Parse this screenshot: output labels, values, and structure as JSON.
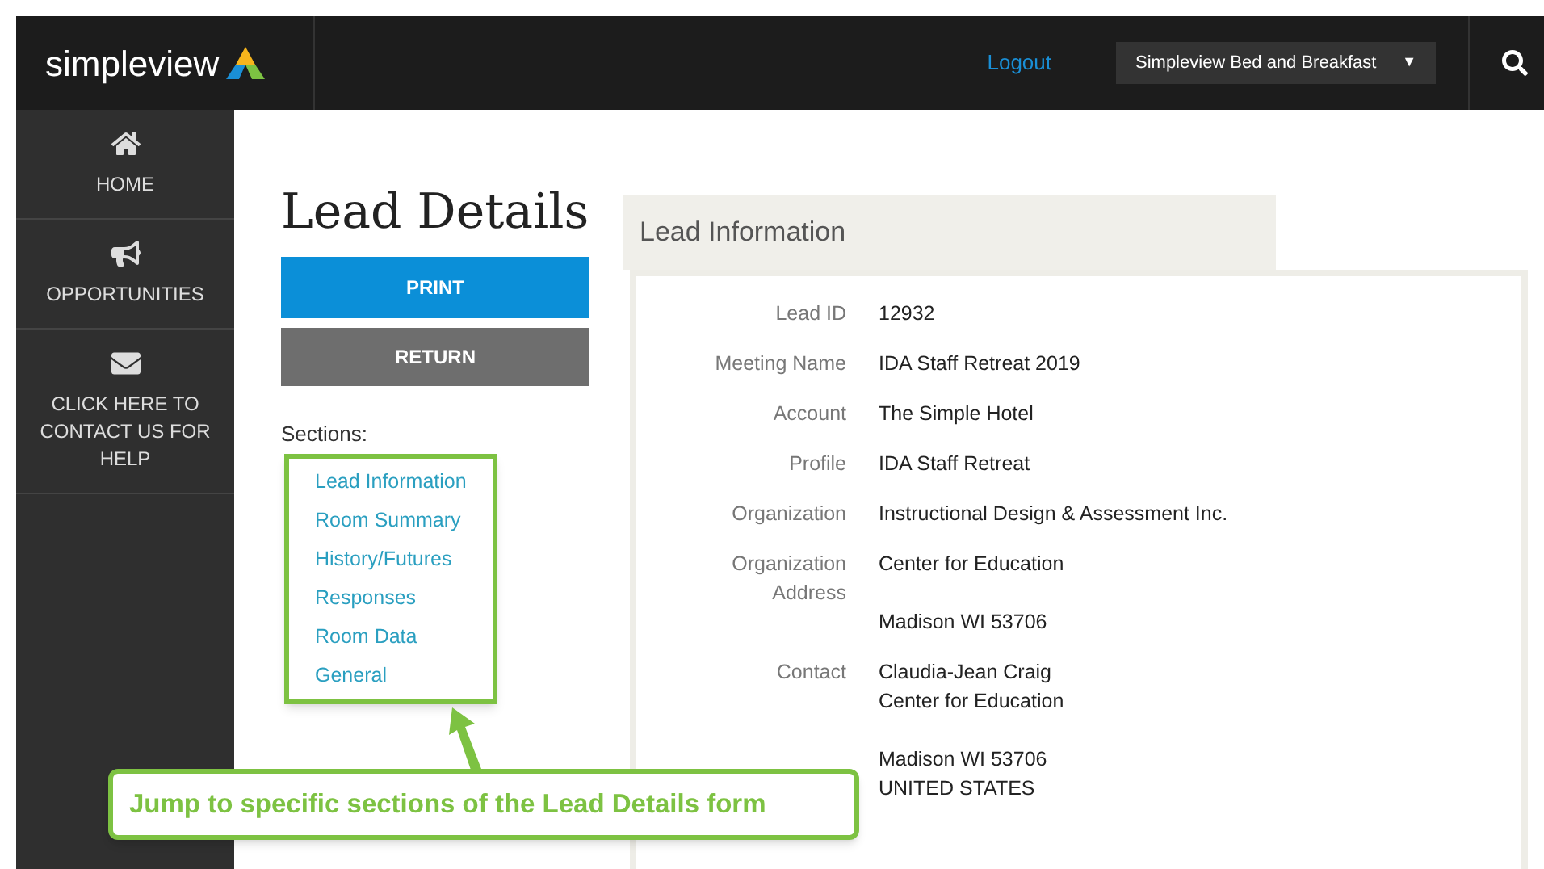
{
  "header": {
    "logo": "simpleview",
    "logout": "Logout",
    "property_select": {
      "value": "Simpleview Bed and Breakfast",
      "caret": "▼"
    }
  },
  "sidebar": {
    "items": [
      {
        "label": "HOME",
        "kind": "home"
      },
      {
        "label": "OPPORTUNITIES",
        "kind": "megaphone"
      },
      {
        "label": "CLICK HERE TO CONTACT US FOR HELP",
        "kind": "mail"
      }
    ]
  },
  "page_title": "Lead Details",
  "buttons": [
    {
      "label": "PRINT",
      "kind": "primary"
    },
    {
      "label": "RETURN",
      "kind": "secondary"
    }
  ],
  "sections": {
    "label": "Sections:",
    "links": [
      "Lead Information",
      "Room Summary",
      "History/Futures",
      "Responses",
      "Room Data",
      "General"
    ]
  },
  "panel": {
    "title": "Lead Information",
    "fields": [
      {
        "label": "Lead ID",
        "lines": [
          "12932"
        ]
      },
      {
        "label": "Meeting Name",
        "lines": [
          "IDA Staff Retreat 2019"
        ]
      },
      {
        "label": "Account",
        "lines": [
          "The Simple Hotel"
        ]
      },
      {
        "label": "Profile",
        "lines": [
          "IDA Staff Retreat"
        ]
      },
      {
        "label": "Organization",
        "lines": [
          "Instructional Design & Assessment Inc."
        ]
      },
      {
        "label": "Organization Address",
        "lines": [
          [
            "Center for Education"
          ],
          [
            "Madison WI 53706"
          ]
        ]
      },
      {
        "label": "Contact",
        "lines": [
          [
            "Claudia-Jean Craig",
            "Center for Education"
          ],
          [
            "Madison WI 53706",
            "UNITED STATES"
          ]
        ]
      }
    ]
  },
  "callout": "Jump to specific sections of the Lead Details form"
}
